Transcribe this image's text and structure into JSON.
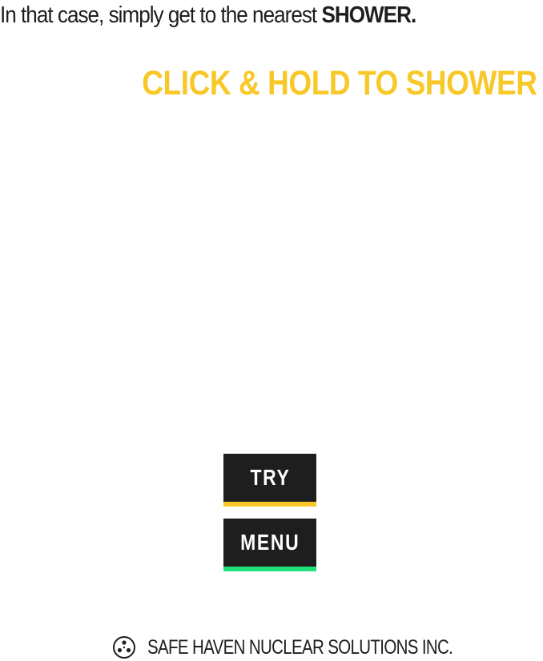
{
  "intro": {
    "text": "In that case, simply get to the nearest ",
    "emphasis": "SHOWER."
  },
  "cta": {
    "label": "CLICK & HOLD TO SHOWER",
    "color": "#f8c828"
  },
  "buttons": {
    "try": {
      "label": "TRY",
      "accent": "#f8c828"
    },
    "menu": {
      "label": "MENU",
      "accent": "#22e07a"
    }
  },
  "footer": {
    "icon": "radiation-logo-icon",
    "text": "SAFE HAVEN NUCLEAR SOLUTIONS INC."
  }
}
